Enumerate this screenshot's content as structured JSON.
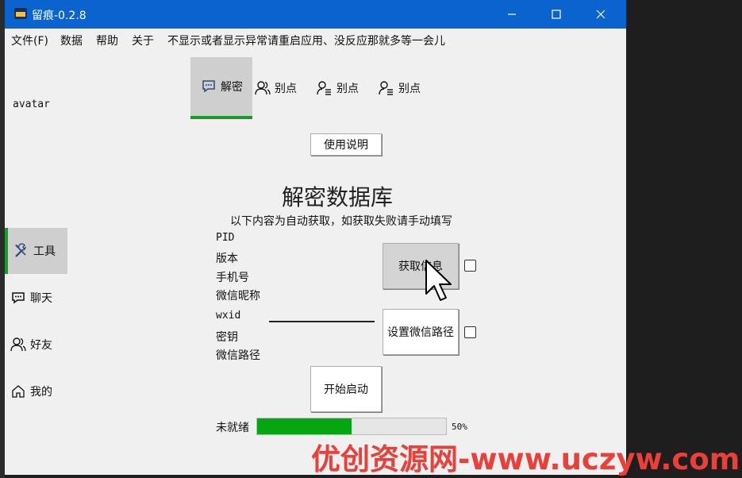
{
  "window": {
    "title": "留痕-0.2.8",
    "controls": [
      "minimize-icon",
      "maximize-icon",
      "close-icon"
    ]
  },
  "menubar": {
    "items": [
      "文件(F)",
      "数据",
      "帮助",
      "关于"
    ],
    "notice": "不显示或者显示异常请重启应用、没反应那就多等一会儿"
  },
  "sidebar": {
    "avatar_label": "avatar",
    "items": [
      {
        "label": "工具",
        "icon": "tools-icon",
        "active": true
      },
      {
        "label": "聊天",
        "icon": "chat-icon",
        "active": false
      },
      {
        "label": "好友",
        "icon": "friends-icon",
        "active": false
      },
      {
        "label": "我的",
        "icon": "home-icon",
        "active": false
      }
    ]
  },
  "tabs": [
    {
      "label": "解密",
      "icon": "chat-bubble-icon",
      "active": true
    },
    {
      "label": "别点",
      "icon": "user-icon",
      "active": false
    },
    {
      "label": "别点",
      "icon": "user-list-icon",
      "active": false
    },
    {
      "label": "别点",
      "icon": "user-list-icon",
      "active": false
    }
  ],
  "main": {
    "help_button": "使用说明",
    "heading": "解密数据库",
    "subtitle": "以下内容为自动获取，如获取失败请手动填写",
    "fields": [
      "PID",
      "版本",
      "手机号",
      "微信昵称",
      "wxid",
      "密钥",
      "微信路径"
    ],
    "get_info_button": "获取信息",
    "set_path_button": "设置微信路径",
    "start_button": "开始启动",
    "status_label": "未就绪",
    "progress": 50,
    "progress_text": "50%",
    "accent_color": "#06a512"
  },
  "watermark": "优创资源网-www.uczyw.com"
}
